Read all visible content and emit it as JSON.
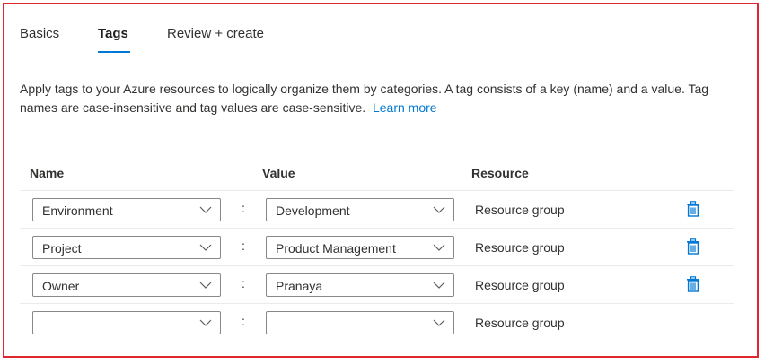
{
  "tabs": [
    {
      "label": "Basics"
    },
    {
      "label": "Tags"
    },
    {
      "label": "Review + create"
    }
  ],
  "description": {
    "text": "Apply tags to your Azure resources to logically organize them by categories. A tag consists of a key (name) and a value. Tag names are case-insensitive and tag values are case-sensitive.",
    "link": "Learn more"
  },
  "table": {
    "headers": {
      "name": "Name",
      "value": "Value",
      "resource": "Resource"
    },
    "rows": [
      {
        "name": "Environment",
        "value": "Development",
        "resource": "Resource group",
        "deletable": true
      },
      {
        "name": "Project",
        "value": "Product Management",
        "resource": "Resource group",
        "deletable": true
      },
      {
        "name": "Owner",
        "value": "Pranaya",
        "resource": "Resource group",
        "deletable": true
      },
      {
        "name": "",
        "value": "",
        "resource": "Resource group",
        "deletable": false
      }
    ],
    "separator": ":"
  },
  "colors": {
    "accent": "#0078d4",
    "highlight_border": "#e0262f",
    "text": "#323130"
  },
  "icons": {
    "dropdown": "chevron-down-icon",
    "delete": "trash-icon"
  }
}
